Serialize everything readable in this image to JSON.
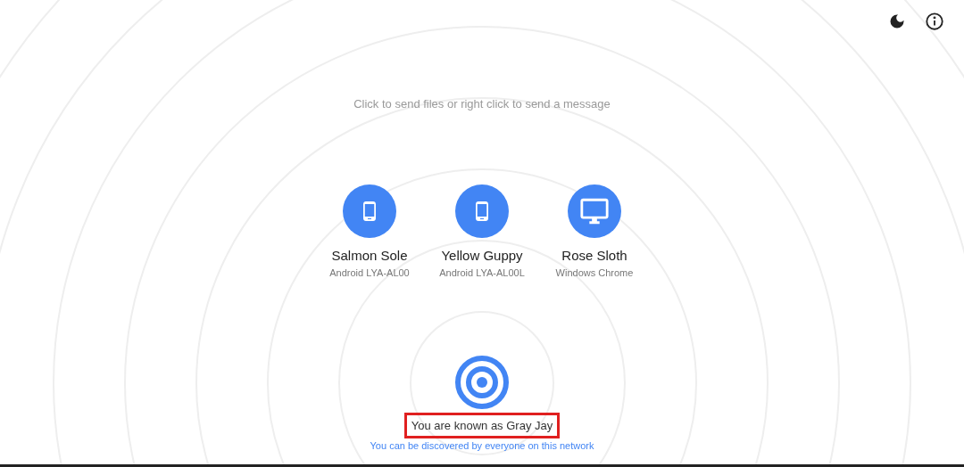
{
  "instructions": "Click to send files or right click to send a message",
  "peers": [
    {
      "name": "Salmon Sole",
      "device": "Android LYA-AL00",
      "kind": "phone"
    },
    {
      "name": "Yellow Guppy",
      "device": "Android LYA-AL00L",
      "kind": "phone"
    },
    {
      "name": "Rose Sloth",
      "device": "Windows Chrome",
      "kind": "desktop"
    }
  ],
  "footer": {
    "display_name": "You are known as Gray Jay",
    "highlighted": true,
    "discovery": "You can be discovered by everyone on this network"
  }
}
